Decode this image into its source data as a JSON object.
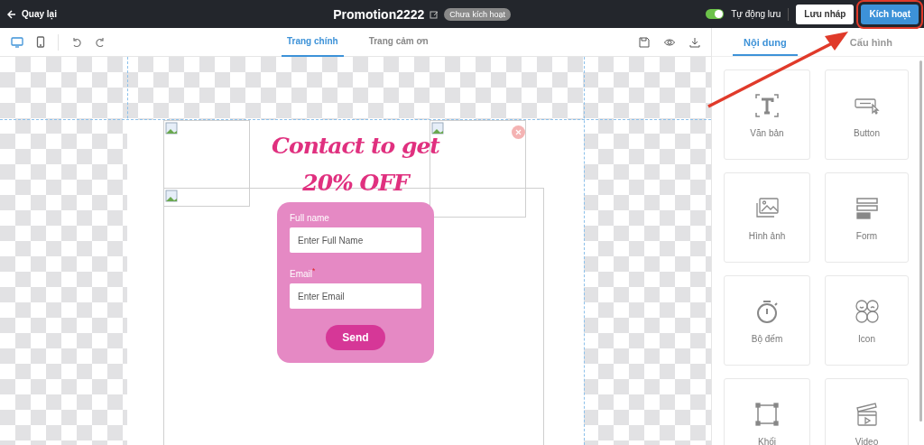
{
  "top_bar": {
    "back": "Quay lại",
    "title": "Promotion2222",
    "status_badge": "Chưa kích hoạt",
    "autosave": {
      "label": "Tự động lưu",
      "on": true
    },
    "buttons": [
      {
        "label": "Lưu nháp",
        "kind": "secondary"
      },
      {
        "label": "Kích hoạt",
        "kind": "primary",
        "highlighted": true
      }
    ]
  },
  "toolbar": {
    "devices": [
      {
        "kind": "desktop",
        "selected": true
      },
      {
        "kind": "mobile",
        "selected": false
      }
    ],
    "page_tabs": [
      {
        "label": "Trang chính",
        "selected": true
      },
      {
        "label": "Trang cảm ơn",
        "selected": false
      }
    ]
  },
  "canvas": {
    "popup": {
      "title_lines": [
        "Contact to get",
        "20% OFF"
      ],
      "form": {
        "fields": [
          {
            "label": "Full name",
            "placeholder": "Enter Full Name"
          },
          {
            "label": "Email$^{*}$",
            "placeholder": "Enter Email"
          }
        ],
        "submit": "Send"
      }
    }
  },
  "side_panel": {
    "tabs": [
      {
        "label": "Nội dung",
        "selected": true
      },
      {
        "label": "Cấu hình",
        "selected": false
      }
    ],
    "elements": [
      {
        "label": "Văn bản",
        "kind": "text"
      },
      {
        "label": "Button",
        "kind": "button"
      },
      {
        "label": "Hình ảnh",
        "kind": "image"
      },
      {
        "label": "Form",
        "kind": "form"
      },
      {
        "label": "Bộ đếm",
        "kind": "timer"
      },
      {
        "label": "Icon",
        "kind": "icon"
      },
      {
        "label": "Khối",
        "kind": "block"
      },
      {
        "label": "Video",
        "kind": "video"
      }
    ]
  }
}
